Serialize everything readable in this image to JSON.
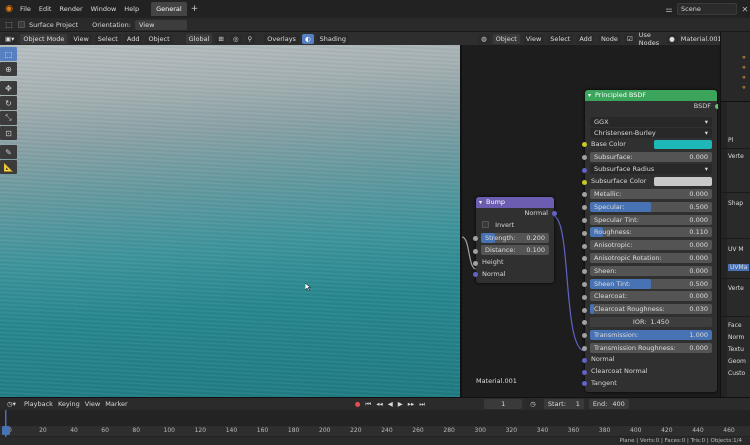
{
  "topbar": {
    "menus": [
      "File",
      "Edit",
      "Render",
      "Window",
      "Help"
    ],
    "workspace_tab": "General",
    "add_tab": "+",
    "scene_name": "Scene"
  },
  "tool_settings": {
    "surface_project_label": "Surface Project",
    "orientation_label": "Orientation:",
    "orientation_value": "View"
  },
  "viewport_header": {
    "mode": "Object Mode",
    "menus": [
      "View",
      "Select",
      "Add",
      "Object"
    ],
    "transform": "Global",
    "overlays": "Overlays",
    "shading": "Shading"
  },
  "node_header": {
    "object": "Object",
    "menus": [
      "View",
      "Select",
      "Add",
      "Node"
    ],
    "use_nodes_label": "Use Nodes",
    "material_name": "Material.001"
  },
  "node_editor": {
    "material_label": "Material.001",
    "bump": {
      "title": "Bump",
      "output": "Normal",
      "invert_label": "Invert",
      "strength_label": "Strength:",
      "strength_value": "0.200",
      "strength_fraction": 0.2,
      "distance_label": "Distance:",
      "distance_value": "0.100",
      "height_label": "Height",
      "normal_label": "Normal"
    },
    "bsdf": {
      "title": "Principled BSDF",
      "output": "BSDF",
      "distribution": "GGX",
      "subsurface_method": "Christensen-Burley",
      "base_color_label": "Base Color",
      "base_color": "#1fb8b8",
      "subsurface_label": "Subsurface:",
      "subsurface_value": "0.000",
      "subsurface_radius_label": "Subsurface Radius",
      "subsurface_color_label": "Subsurface Color",
      "subsurface_color": "#c9c9c9",
      "sliders": [
        {
          "label": "Metallic:",
          "value": "0.000",
          "fraction": 0.0
        },
        {
          "label": "Specular:",
          "value": "0.500",
          "fraction": 0.5
        },
        {
          "label": "Specular Tint:",
          "value": "0.000",
          "fraction": 0.0
        },
        {
          "label": "Roughness:",
          "value": "0.110",
          "fraction": 0.11
        },
        {
          "label": "Anisotropic:",
          "value": "0.000",
          "fraction": 0.0
        },
        {
          "label": "Anisotropic Rotation:",
          "value": "0.000",
          "fraction": 0.0
        },
        {
          "label": "Sheen:",
          "value": "0.000",
          "fraction": 0.0
        },
        {
          "label": "Sheen Tint:",
          "value": "0.500",
          "fraction": 0.5
        },
        {
          "label": "Clearcoat:",
          "value": "0.000",
          "fraction": 0.0
        },
        {
          "label": "Clearcoat Roughness:",
          "value": "0.030",
          "fraction": 0.03
        }
      ],
      "ior_label": "IOR:",
      "ior_value": "1.450",
      "transmission_label": "Transmission:",
      "transmission_value": "1.000",
      "transmission_fraction": 1.0,
      "transmission_roughness_label": "Transmission Roughness:",
      "transmission_roughness_value": "0.000",
      "normal_label": "Normal",
      "clearcoat_normal_label": "Clearcoat Normal",
      "tangent_label": "Tangent"
    }
  },
  "properties": {
    "labels": [
      "Verte",
      "Shap",
      "UV M",
      "UVMa",
      "Verte",
      "Face",
      "Norm",
      "Textu",
      "Geom",
      "Custo"
    ],
    "header_fragment": "Pl"
  },
  "timeline": {
    "menus": [
      "Playback",
      "Keying",
      "View",
      "Marker"
    ],
    "current_frame": "1",
    "start_label": "Start:",
    "start_value": "1",
    "end_label": "End:",
    "end_value": "400",
    "ticks": [
      "0",
      "20",
      "40",
      "60",
      "80",
      "100",
      "120",
      "140",
      "160",
      "180",
      "200",
      "220",
      "240",
      "260",
      "280",
      "300",
      "320",
      "340",
      "360",
      "380",
      "400",
      "420",
      "440",
      "460"
    ],
    "playhead_label": "0"
  },
  "statusbar": {
    "text": "Plane | Verts:0 | Faces:0 | Tris:0 | Objects:1/4"
  }
}
